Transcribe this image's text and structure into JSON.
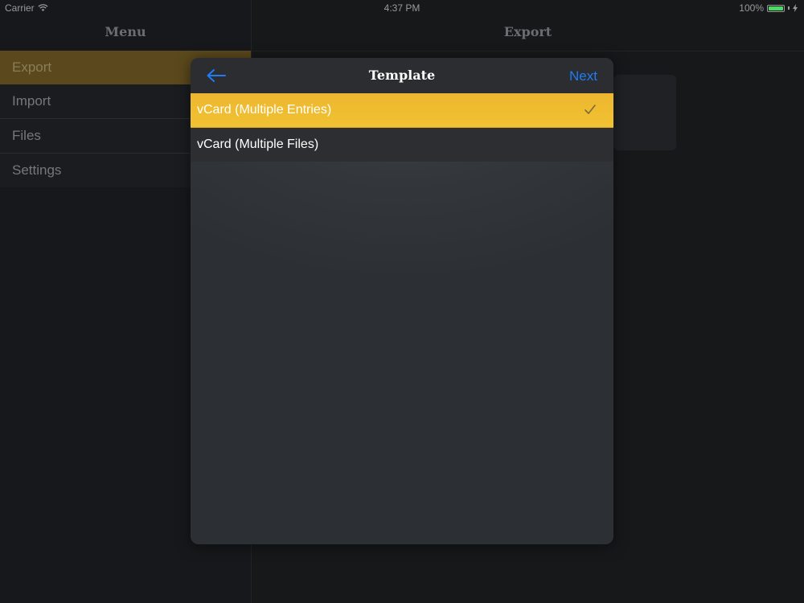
{
  "status_bar": {
    "carrier": "Carrier",
    "time": "4:37 PM",
    "battery_percent_label": "100%",
    "battery_level": 1.0,
    "icons": [
      "wifi-icon",
      "battery-icon",
      "charging-icon"
    ]
  },
  "master": {
    "title": "Menu",
    "items": [
      {
        "label": "Export",
        "selected": true
      },
      {
        "label": "Import",
        "selected": false
      },
      {
        "label": "Files",
        "selected": false
      },
      {
        "label": "Settings",
        "selected": false
      }
    ]
  },
  "detail": {
    "title": "Export"
  },
  "modal": {
    "title": "Template",
    "back_icon": "arrow-left-icon",
    "next_label": "Next",
    "options": [
      {
        "label": "vCard (Multiple Entries)",
        "selected": true,
        "icon": "checkmark-icon"
      },
      {
        "label": "vCard (Multiple Files)",
        "selected": false
      }
    ]
  },
  "colors": {
    "accent": "#1f7cf4",
    "selected_row": "#f0bc31",
    "selected_menu": "#7a6227",
    "battery": "#4cd964"
  }
}
